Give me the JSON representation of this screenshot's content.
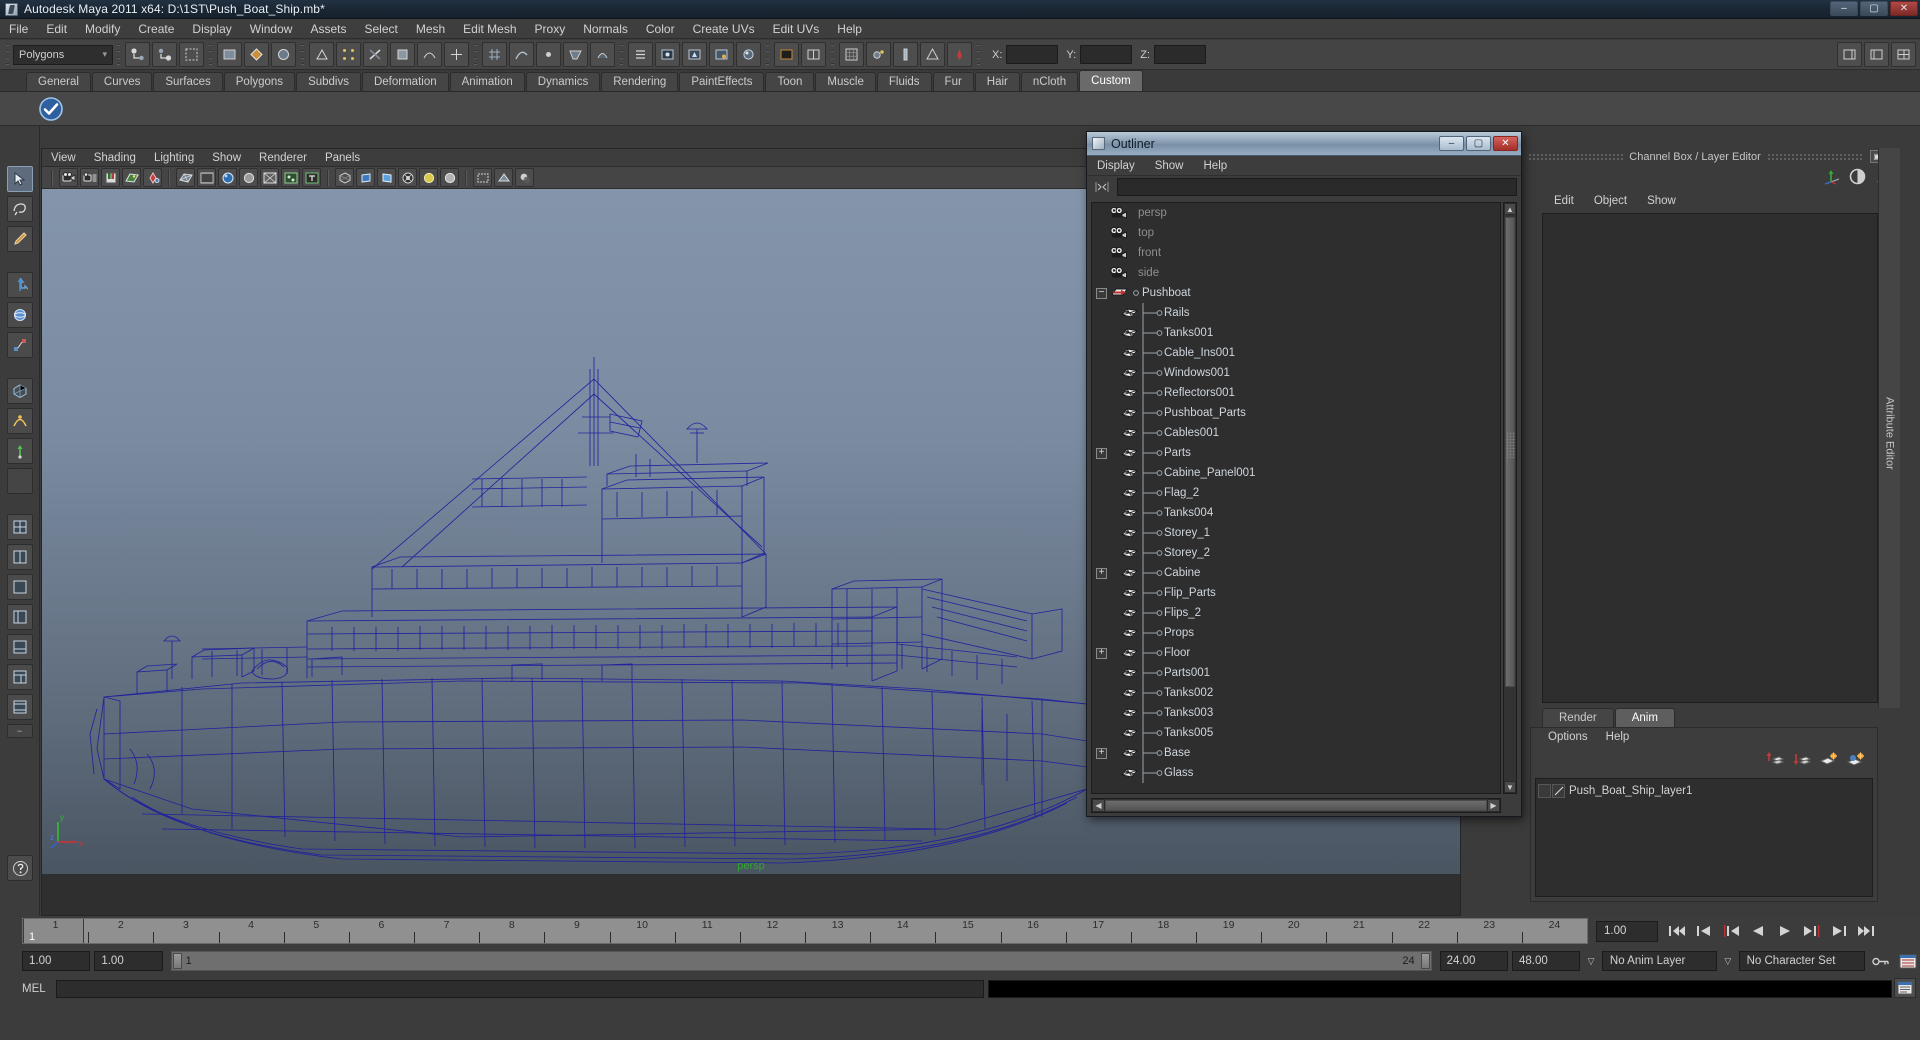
{
  "window": {
    "title": "Autodesk Maya 2011 x64: D:\\1ST\\Push_Boat_Ship.mb*",
    "app_icon": "maya-logo-icon",
    "minimize": "–",
    "maximize": "▢",
    "close": "✕"
  },
  "menubar": {
    "items": [
      "File",
      "Edit",
      "Modify",
      "Create",
      "Display",
      "Window",
      "Assets",
      "Select",
      "Mesh",
      "Edit Mesh",
      "Proxy",
      "Normals",
      "Color",
      "Create UVs",
      "Edit UVs",
      "Help"
    ]
  },
  "statusline": {
    "mode_selector": "Polygons",
    "axis_labels": {
      "x": "X:",
      "y": "Y:",
      "z": "Z:"
    },
    "x_value": "",
    "y_value": "",
    "z_value": ""
  },
  "shelf": {
    "tabs": [
      "General",
      "Curves",
      "Surfaces",
      "Polygons",
      "Subdivs",
      "Deformation",
      "Animation",
      "Dynamics",
      "Rendering",
      "PaintEffects",
      "Toon",
      "Muscle",
      "Fluids",
      "Fur",
      "Hair",
      "nCloth",
      "Custom"
    ],
    "active_tab": "Custom",
    "icons": [
      "blue-check-circle-icon"
    ]
  },
  "viewport_panel": {
    "menus": [
      "View",
      "Shading",
      "Lighting",
      "Show",
      "Renderer",
      "Panels"
    ],
    "camera_label": "persp",
    "axis_gizmo": {
      "y": "y",
      "x": "x",
      "z": "z"
    },
    "toolbar_icons": [
      "camera-icon",
      "camera-attributes-icon",
      "bookmark-icon",
      "image-plane-icon",
      "keyframe-icon",
      "wireframe-icon",
      "smooth-shade-icon",
      "hardware-texture-icon",
      "lighting-icon",
      "xray-icon",
      "xray-joints-icon",
      "textured-icon",
      "grid-icon",
      "film-gate-icon",
      "resolution-gate-icon",
      "field-chart-icon",
      "safe-action-icon",
      "safe-title-icon",
      "isolate-select-icon",
      "two-sided-lighting-icon",
      "shadows-icon"
    ]
  },
  "outliner": {
    "title": "Outliner",
    "window_icon": "maya-logo-icon",
    "minimize": "–",
    "maximize": "▢",
    "close": "✕",
    "menus": [
      "Display",
      "Show",
      "Help"
    ],
    "search_value": "",
    "search_icon": "search-filter-icon",
    "items": [
      {
        "label": "persp",
        "icon": "camera-icon",
        "indent": 0,
        "expand": "none",
        "dim": true,
        "connector": false
      },
      {
        "label": "top",
        "icon": "camera-icon",
        "indent": 0,
        "expand": "none",
        "dim": true,
        "connector": false
      },
      {
        "label": "front",
        "icon": "camera-icon",
        "indent": 0,
        "expand": "none",
        "dim": true,
        "connector": false
      },
      {
        "label": "side",
        "icon": "camera-icon",
        "indent": 0,
        "expand": "none",
        "dim": true,
        "connector": false
      },
      {
        "label": "Pushboat",
        "icon": "transform-icon",
        "indent": 0,
        "expand": "minus",
        "dim": false,
        "connector": false
      },
      {
        "label": "Rails",
        "icon": "mesh-icon",
        "indent": 1,
        "expand": "none",
        "dim": false,
        "connector": true
      },
      {
        "label": "Tanks001",
        "icon": "mesh-icon",
        "indent": 1,
        "expand": "none",
        "dim": false,
        "connector": true
      },
      {
        "label": "Cable_Ins001",
        "icon": "mesh-icon",
        "indent": 1,
        "expand": "none",
        "dim": false,
        "connector": true
      },
      {
        "label": "Windows001",
        "icon": "mesh-icon",
        "indent": 1,
        "expand": "none",
        "dim": false,
        "connector": true
      },
      {
        "label": "Reflectors001",
        "icon": "mesh-icon",
        "indent": 1,
        "expand": "none",
        "dim": false,
        "connector": true
      },
      {
        "label": "Pushboat_Parts",
        "icon": "mesh-icon",
        "indent": 1,
        "expand": "none",
        "dim": false,
        "connector": true
      },
      {
        "label": "Cables001",
        "icon": "mesh-icon",
        "indent": 1,
        "expand": "none",
        "dim": false,
        "connector": true
      },
      {
        "label": "Parts",
        "icon": "mesh-icon",
        "indent": 1,
        "expand": "plus",
        "dim": false,
        "connector": true
      },
      {
        "label": "Cabine_Panel001",
        "icon": "mesh-icon",
        "indent": 1,
        "expand": "none",
        "dim": false,
        "connector": true
      },
      {
        "label": "Flag_2",
        "icon": "mesh-icon",
        "indent": 1,
        "expand": "none",
        "dim": false,
        "connector": true
      },
      {
        "label": "Tanks004",
        "icon": "mesh-icon",
        "indent": 1,
        "expand": "none",
        "dim": false,
        "connector": true
      },
      {
        "label": "Storey_1",
        "icon": "mesh-icon",
        "indent": 1,
        "expand": "none",
        "dim": false,
        "connector": true
      },
      {
        "label": "Storey_2",
        "icon": "mesh-icon",
        "indent": 1,
        "expand": "none",
        "dim": false,
        "connector": true
      },
      {
        "label": "Cabine",
        "icon": "mesh-icon",
        "indent": 1,
        "expand": "plus",
        "dim": false,
        "connector": true
      },
      {
        "label": "Flip_Parts",
        "icon": "mesh-icon",
        "indent": 1,
        "expand": "none",
        "dim": false,
        "connector": true
      },
      {
        "label": "Flips_2",
        "icon": "mesh-icon",
        "indent": 1,
        "expand": "none",
        "dim": false,
        "connector": true
      },
      {
        "label": "Props",
        "icon": "mesh-icon",
        "indent": 1,
        "expand": "none",
        "dim": false,
        "connector": true
      },
      {
        "label": "Floor",
        "icon": "mesh-icon",
        "indent": 1,
        "expand": "plus",
        "dim": false,
        "connector": true
      },
      {
        "label": "Parts001",
        "icon": "mesh-icon",
        "indent": 1,
        "expand": "none",
        "dim": false,
        "connector": true
      },
      {
        "label": "Tanks002",
        "icon": "mesh-icon",
        "indent": 1,
        "expand": "none",
        "dim": false,
        "connector": true
      },
      {
        "label": "Tanks003",
        "icon": "mesh-icon",
        "indent": 1,
        "expand": "none",
        "dim": false,
        "connector": true
      },
      {
        "label": "Tanks005",
        "icon": "mesh-icon",
        "indent": 1,
        "expand": "none",
        "dim": false,
        "connector": true
      },
      {
        "label": "Base",
        "icon": "mesh-icon",
        "indent": 1,
        "expand": "plus",
        "dim": false,
        "connector": true
      },
      {
        "label": "Glass",
        "icon": "mesh-icon",
        "indent": 1,
        "expand": "none",
        "dim": false,
        "connector": true
      }
    ]
  },
  "right_panel": {
    "header_title": "Channel Box / Layer Editor",
    "restore_icon": "restore-icon",
    "close_icon": "close-icon",
    "side_tab_1": "Channel Box / Layer Editor",
    "side_tab_2": "Attribute Editor",
    "channel_menus": [
      "Edit",
      "Object",
      "Show"
    ],
    "tool_icons": [
      "move-axis-icon",
      "half-circle-icon",
      "arrow-up-right-icon"
    ],
    "layer_tabs": [
      "Render",
      "Anim"
    ],
    "layer_active_tab": "Anim",
    "layer_menus": [
      "Options",
      "Help"
    ],
    "layer_buttons": [
      "move-layer-up-icon",
      "move-layer-down-icon",
      "new-layer-icon",
      "new-layer-from-selected-icon"
    ],
    "layers": [
      {
        "name": "Push_Boat_Ship_layer1",
        "visible": "",
        "playback": ""
      }
    ]
  },
  "timeslider": {
    "ticks": [
      "1",
      "2",
      "3",
      "4",
      "5",
      "6",
      "7",
      "8",
      "9",
      "10",
      "11",
      "12",
      "13",
      "14",
      "15",
      "16",
      "17",
      "18",
      "19",
      "20",
      "21",
      "22",
      "23",
      "24"
    ],
    "current_frame_marker": "1",
    "current_frame_field": "1.00",
    "playback_buttons": [
      "go-to-start-icon",
      "step-back-frame-icon",
      "step-back-key-icon",
      "play-backwards-icon",
      "play-forwards-icon",
      "step-forward-key-icon",
      "step-forward-frame-icon",
      "go-to-end-icon"
    ]
  },
  "rangeslider": {
    "anim_start": "1.00",
    "range_start": "1.00",
    "range_bar_min": "1",
    "range_bar_max": "24",
    "range_end": "24.00",
    "anim_end": "48.00",
    "anim_layer": "No Anim Layer",
    "character_set": "No Character Set",
    "key_icon": "auto-keyframe-icon",
    "prefs_icon": "animation-preferences-icon"
  },
  "command_line": {
    "label": "MEL",
    "input_value": "",
    "output_value": "",
    "script_editor_icon": "script-editor-icon"
  },
  "colors": {
    "wireframe_blue": "#2222aa",
    "viewport_top": "#8495ab",
    "viewport_bottom": "#4a5562",
    "accent_green": "#2ea82e",
    "title_bar": "#1b2836",
    "panel_bg": "#3c3c3c"
  }
}
